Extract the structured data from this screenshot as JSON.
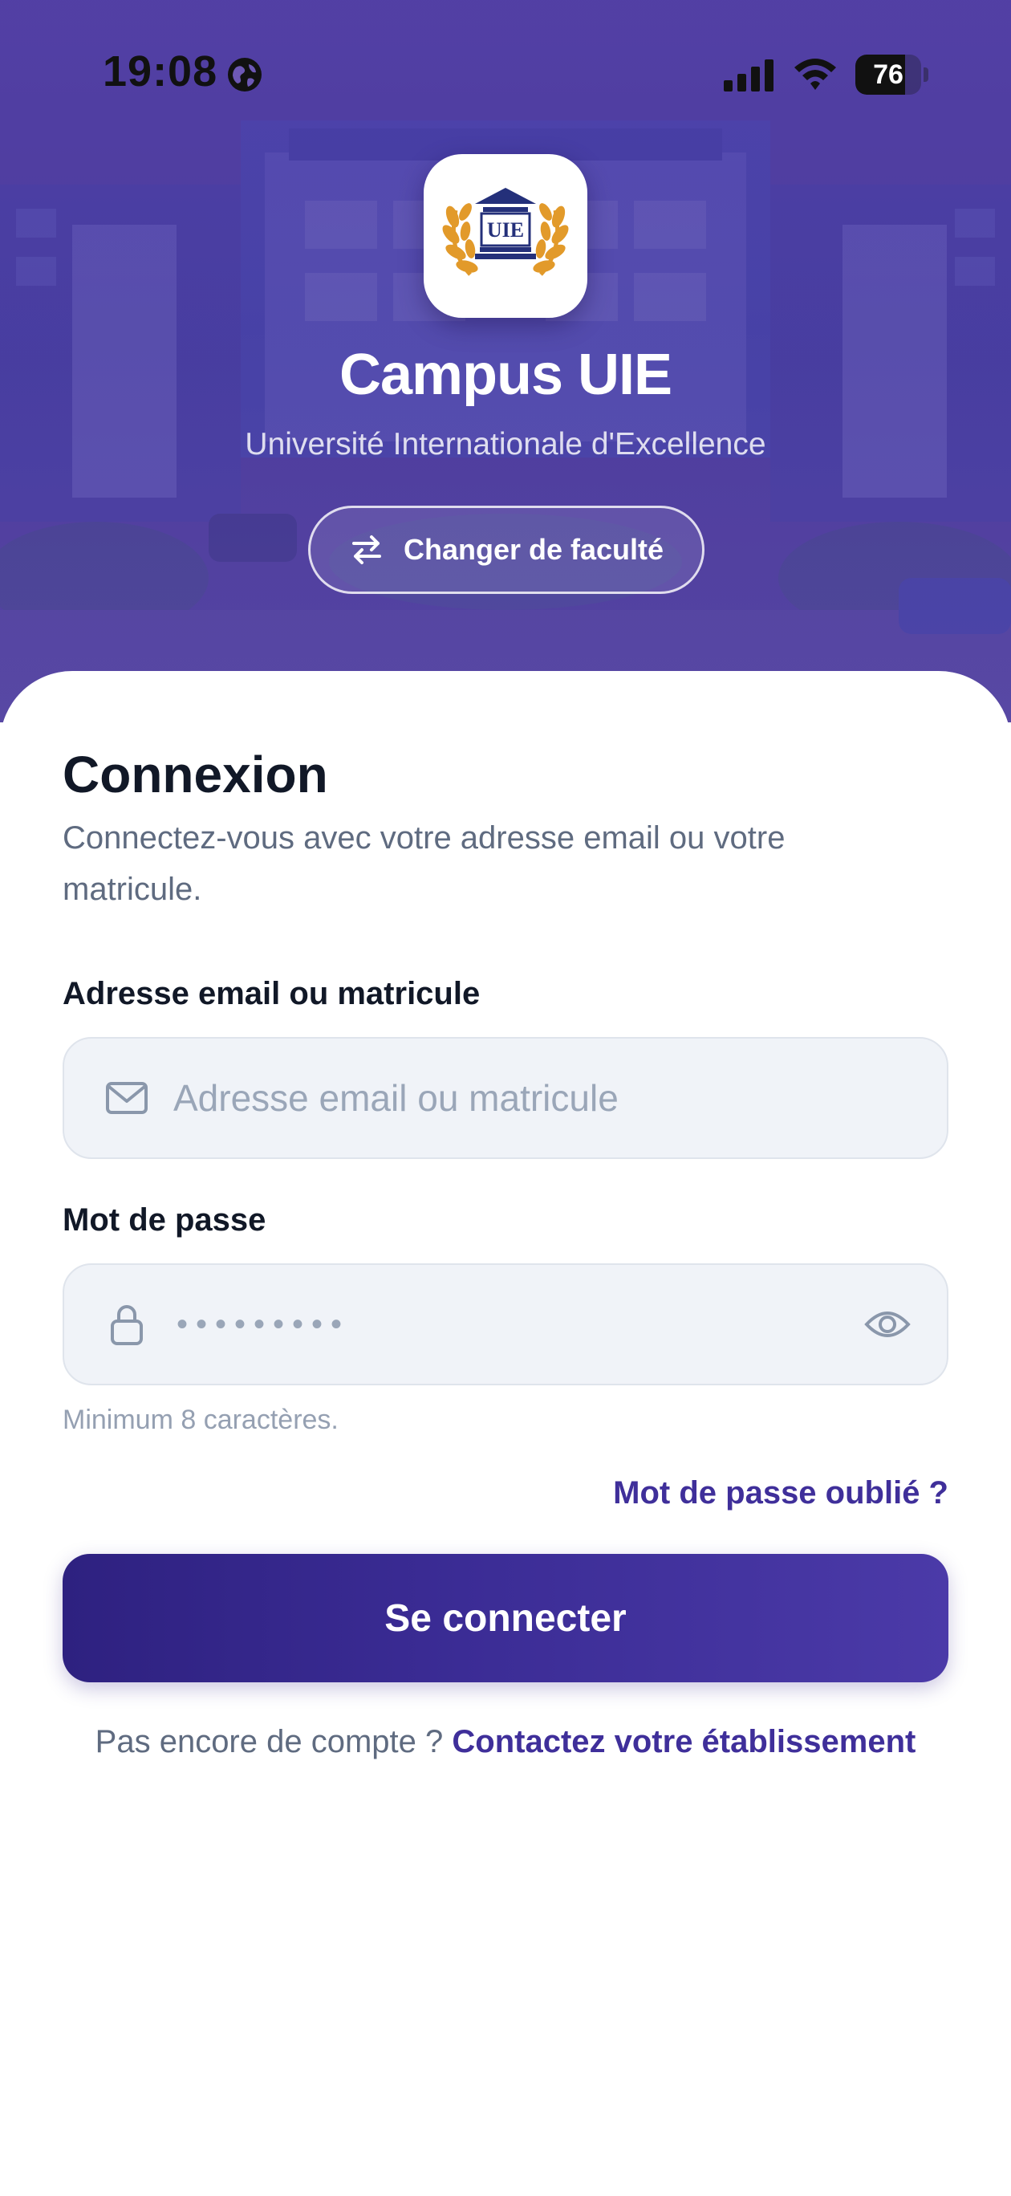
{
  "status_bar": {
    "time": "19:08",
    "battery": "76",
    "battery_level": 0.76
  },
  "hero": {
    "title": "Campus UIE",
    "subtitle": "Université Internationale d'Excellence",
    "logo_text": "UIE",
    "faculty_button_label": "Changer de faculté"
  },
  "login": {
    "title": "Connexion",
    "description": "Connectez-vous avec votre adresse email ou votre matricule.",
    "email_label": "Adresse email ou matricule",
    "email_placeholder": "Adresse email ou matricule",
    "password_label": "Mot de passe",
    "password_value": "•••••••••",
    "password_hint": "Minimum 8 caractères.",
    "forgot_link": "Mot de passe oublié ?",
    "submit_label": "Se connecter",
    "signup_prompt": "Pas encore de compte ?",
    "signup_link": "Contactez votre établissement"
  },
  "icons": {
    "status": [
      "globe-icon",
      "signal-icon",
      "wifi-icon",
      "battery-icon"
    ],
    "faculty_button": "swap-arrows-icon",
    "email_field": "mail-icon",
    "password_field": "lock-icon",
    "password_toggle": "eye-icon"
  },
  "colors": {
    "primary": "#3f2f9a",
    "hero_overlay": "#5a46a8",
    "field_bg": "#f0f3f8",
    "muted_text": "#5f6b80",
    "logo_gold": "#e29a2a",
    "logo_navy": "#24307a"
  }
}
